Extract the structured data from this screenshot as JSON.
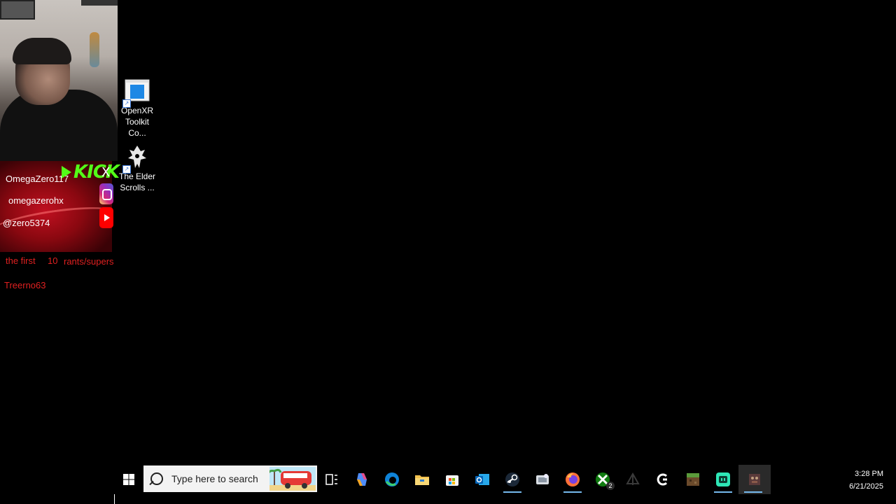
{
  "overlay": {
    "kick_handle": "OmegaZero117",
    "kick_logo": "KICK",
    "x_logo": "X",
    "instagram_handle": "omegazerohx",
    "youtube_handle": "@zero5374",
    "rants_label_1": "the first",
    "rants_count": "10",
    "rants_label_2": "rants/supers",
    "supporter": "Treerno63"
  },
  "desktop": {
    "icons": [
      {
        "label": "OpenXR Toolkit Co...",
        "icon": "openxr-toolkit-icon"
      },
      {
        "label": "The Elder Scrolls ...",
        "icon": "skyrim-icon"
      }
    ]
  },
  "taskbar": {
    "search_placeholder": "Type here to search",
    "apps": [
      "task-view",
      "copilot",
      "edge",
      "file-explorer",
      "microsoft-store",
      "outlook",
      "steam",
      "cloud-app",
      "firefox",
      "xbox",
      "destiny",
      "logitech-g",
      "minecraft",
      "twitch-studio",
      "game-app"
    ],
    "xbox_badge": "2",
    "time": "3:28 PM",
    "date": "6/21/2025",
    "accent": "#76b9ed"
  }
}
